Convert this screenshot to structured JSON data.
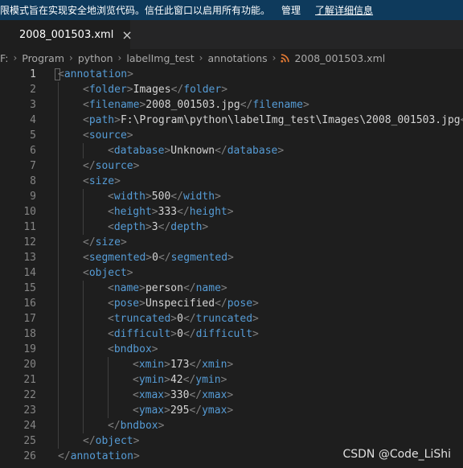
{
  "banner": {
    "message": "限模式旨在实现安全地浏览代码。信任此窗口以启用所有功能。",
    "manage_label": "管理",
    "learn_more_label": "了解详细信息"
  },
  "tab": {
    "label": "2008_001503.xml",
    "close_glyph": "×",
    "icon": "rss-icon"
  },
  "breadcrumb": [
    "F:",
    "Program",
    "python",
    "labelImg_test",
    "annotations",
    "2008_001503.xml"
  ],
  "breadcrumb_separator": "›",
  "editor": {
    "lines": [
      {
        "n": "1",
        "indent": 0,
        "parts": [
          [
            "b",
            "<"
          ],
          [
            "t",
            "annotation"
          ],
          [
            "b",
            ">"
          ]
        ]
      },
      {
        "n": "2",
        "indent": 1,
        "parts": [
          [
            "b",
            "<"
          ],
          [
            "t",
            "folder"
          ],
          [
            "b",
            ">"
          ],
          [
            "v",
            "Images"
          ],
          [
            "b",
            "</"
          ],
          [
            "t",
            "folder"
          ],
          [
            "b",
            ">"
          ]
        ]
      },
      {
        "n": "3",
        "indent": 1,
        "parts": [
          [
            "b",
            "<"
          ],
          [
            "t",
            "filename"
          ],
          [
            "b",
            ">"
          ],
          [
            "v",
            "2008_001503.jpg"
          ],
          [
            "b",
            "</"
          ],
          [
            "t",
            "filename"
          ],
          [
            "b",
            ">"
          ]
        ]
      },
      {
        "n": "4",
        "indent": 1,
        "parts": [
          [
            "b",
            "<"
          ],
          [
            "t",
            "path"
          ],
          [
            "b",
            ">"
          ],
          [
            "v",
            "F:\\Program\\python\\labelImg_test\\Images\\2008_001503.jpg"
          ],
          [
            "b",
            "</"
          ]
        ]
      },
      {
        "n": "5",
        "indent": 1,
        "parts": [
          [
            "b",
            "<"
          ],
          [
            "t",
            "source"
          ],
          [
            "b",
            ">"
          ]
        ]
      },
      {
        "n": "6",
        "indent": 2,
        "parts": [
          [
            "b",
            "<"
          ],
          [
            "t",
            "database"
          ],
          [
            "b",
            ">"
          ],
          [
            "v",
            "Unknown"
          ],
          [
            "b",
            "</"
          ],
          [
            "t",
            "database"
          ],
          [
            "b",
            ">"
          ]
        ]
      },
      {
        "n": "7",
        "indent": 1,
        "parts": [
          [
            "b",
            "</"
          ],
          [
            "t",
            "source"
          ],
          [
            "b",
            ">"
          ]
        ]
      },
      {
        "n": "8",
        "indent": 1,
        "parts": [
          [
            "b",
            "<"
          ],
          [
            "t",
            "size"
          ],
          [
            "b",
            ">"
          ]
        ]
      },
      {
        "n": "9",
        "indent": 2,
        "parts": [
          [
            "b",
            "<"
          ],
          [
            "t",
            "width"
          ],
          [
            "b",
            ">"
          ],
          [
            "v",
            "500"
          ],
          [
            "b",
            "</"
          ],
          [
            "t",
            "width"
          ],
          [
            "b",
            ">"
          ]
        ]
      },
      {
        "n": "10",
        "indent": 2,
        "parts": [
          [
            "b",
            "<"
          ],
          [
            "t",
            "height"
          ],
          [
            "b",
            ">"
          ],
          [
            "v",
            "333"
          ],
          [
            "b",
            "</"
          ],
          [
            "t",
            "height"
          ],
          [
            "b",
            ">"
          ]
        ]
      },
      {
        "n": "11",
        "indent": 2,
        "parts": [
          [
            "b",
            "<"
          ],
          [
            "t",
            "depth"
          ],
          [
            "b",
            ">"
          ],
          [
            "v",
            "3"
          ],
          [
            "b",
            "</"
          ],
          [
            "t",
            "depth"
          ],
          [
            "b",
            ">"
          ]
        ]
      },
      {
        "n": "12",
        "indent": 1,
        "parts": [
          [
            "b",
            "</"
          ],
          [
            "t",
            "size"
          ],
          [
            "b",
            ">"
          ]
        ]
      },
      {
        "n": "13",
        "indent": 1,
        "parts": [
          [
            "b",
            "<"
          ],
          [
            "t",
            "segmented"
          ],
          [
            "b",
            ">"
          ],
          [
            "v",
            "0"
          ],
          [
            "b",
            "</"
          ],
          [
            "t",
            "segmented"
          ],
          [
            "b",
            ">"
          ]
        ]
      },
      {
        "n": "14",
        "indent": 1,
        "parts": [
          [
            "b",
            "<"
          ],
          [
            "t",
            "object"
          ],
          [
            "b",
            ">"
          ]
        ]
      },
      {
        "n": "15",
        "indent": 2,
        "parts": [
          [
            "b",
            "<"
          ],
          [
            "t",
            "name"
          ],
          [
            "b",
            ">"
          ],
          [
            "v",
            "person"
          ],
          [
            "b",
            "</"
          ],
          [
            "t",
            "name"
          ],
          [
            "b",
            ">"
          ]
        ]
      },
      {
        "n": "16",
        "indent": 2,
        "parts": [
          [
            "b",
            "<"
          ],
          [
            "t",
            "pose"
          ],
          [
            "b",
            ">"
          ],
          [
            "v",
            "Unspecified"
          ],
          [
            "b",
            "</"
          ],
          [
            "t",
            "pose"
          ],
          [
            "b",
            ">"
          ]
        ]
      },
      {
        "n": "17",
        "indent": 2,
        "parts": [
          [
            "b",
            "<"
          ],
          [
            "t",
            "truncated"
          ],
          [
            "b",
            ">"
          ],
          [
            "v",
            "0"
          ],
          [
            "b",
            "</"
          ],
          [
            "t",
            "truncated"
          ],
          [
            "b",
            ">"
          ]
        ]
      },
      {
        "n": "18",
        "indent": 2,
        "parts": [
          [
            "b",
            "<"
          ],
          [
            "t",
            "difficult"
          ],
          [
            "b",
            ">"
          ],
          [
            "v",
            "0"
          ],
          [
            "b",
            "</"
          ],
          [
            "t",
            "difficult"
          ],
          [
            "b",
            ">"
          ]
        ]
      },
      {
        "n": "19",
        "indent": 2,
        "parts": [
          [
            "b",
            "<"
          ],
          [
            "t",
            "bndbox"
          ],
          [
            "b",
            ">"
          ]
        ]
      },
      {
        "n": "20",
        "indent": 3,
        "parts": [
          [
            "b",
            "<"
          ],
          [
            "t",
            "xmin"
          ],
          [
            "b",
            ">"
          ],
          [
            "v",
            "173"
          ],
          [
            "b",
            "</"
          ],
          [
            "t",
            "xmin"
          ],
          [
            "b",
            ">"
          ]
        ]
      },
      {
        "n": "21",
        "indent": 3,
        "parts": [
          [
            "b",
            "<"
          ],
          [
            "t",
            "ymin"
          ],
          [
            "b",
            ">"
          ],
          [
            "v",
            "42"
          ],
          [
            "b",
            "</"
          ],
          [
            "t",
            "ymin"
          ],
          [
            "b",
            ">"
          ]
        ]
      },
      {
        "n": "22",
        "indent": 3,
        "parts": [
          [
            "b",
            "<"
          ],
          [
            "t",
            "xmax"
          ],
          [
            "b",
            ">"
          ],
          [
            "v",
            "330"
          ],
          [
            "b",
            "</"
          ],
          [
            "t",
            "xmax"
          ],
          [
            "b",
            ">"
          ]
        ]
      },
      {
        "n": "23",
        "indent": 3,
        "parts": [
          [
            "b",
            "<"
          ],
          [
            "t",
            "ymax"
          ],
          [
            "b",
            ">"
          ],
          [
            "v",
            "295"
          ],
          [
            "b",
            "</"
          ],
          [
            "t",
            "ymax"
          ],
          [
            "b",
            ">"
          ]
        ]
      },
      {
        "n": "24",
        "indent": 2,
        "parts": [
          [
            "b",
            "</"
          ],
          [
            "t",
            "bndbox"
          ],
          [
            "b",
            ">"
          ]
        ]
      },
      {
        "n": "25",
        "indent": 1,
        "parts": [
          [
            "b",
            "</"
          ],
          [
            "t",
            "object"
          ],
          [
            "b",
            ">"
          ]
        ]
      },
      {
        "n": "26",
        "indent": 0,
        "parts": [
          [
            "b",
            "</"
          ],
          [
            "t",
            "annotation"
          ],
          [
            "b",
            ">"
          ]
        ]
      }
    ]
  },
  "watermark": "CSDN @Code_LiShi",
  "colors": {
    "tag": "#569cd6",
    "bracket": "#808080",
    "text": "#d4d4d4",
    "banner_bg": "#0e3a5c",
    "rss_icon": "#e37933"
  }
}
